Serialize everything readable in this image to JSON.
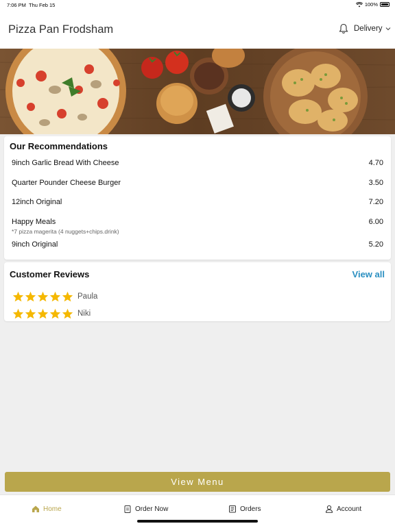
{
  "status_bar": {
    "time": "7:06 PM",
    "date": "Thu Feb 15",
    "battery": "100%"
  },
  "header": {
    "title": "Pizza Pan Frodsham",
    "order_mode": "Delivery",
    "icons": [
      "bell-icon",
      "chevron-down-icon"
    ]
  },
  "recommendations": {
    "title": "Our Recommendations",
    "items": [
      {
        "name": "9inch Garlic Bread With Cheese",
        "price": "4.70",
        "description": ""
      },
      {
        "name": "Quarter Pounder Cheese Burger",
        "price": "3.50",
        "description": ""
      },
      {
        "name": "12inch Original",
        "price": "7.20",
        "description": ""
      },
      {
        "name": "Happy Meals",
        "price": "6.00",
        "description": "*7 pizza magerita (4 nuggets+chips.drink)"
      },
      {
        "name": "9inch Original",
        "price": "5.20",
        "description": ""
      }
    ]
  },
  "reviews": {
    "title": "Customer Reviews",
    "view_all_label": "View all",
    "items": [
      {
        "name": "Paula",
        "rating": 5
      },
      {
        "name": "Niki",
        "rating": 5
      }
    ]
  },
  "view_menu_label": "View Menu",
  "tabs": [
    {
      "label": "Home",
      "icon": "home-icon",
      "active": true
    },
    {
      "label": "Order Now",
      "icon": "clipboard-icon",
      "active": false
    },
    {
      "label": "Orders",
      "icon": "receipt-icon",
      "active": false
    },
    {
      "label": "Account",
      "icon": "user-icon",
      "active": false
    }
  ],
  "colors": {
    "accent": "#b9a64c",
    "link": "#2a8fc1",
    "star": "#f5b800"
  }
}
